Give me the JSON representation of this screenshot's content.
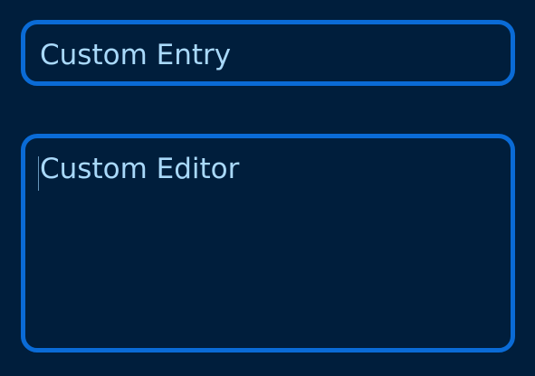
{
  "entry": {
    "value": "Custom Entry"
  },
  "editor": {
    "value": "Custom Editor"
  },
  "colors": {
    "background": "#001e3c",
    "border": "#0a6bd6",
    "text": "#a9d9fa"
  }
}
